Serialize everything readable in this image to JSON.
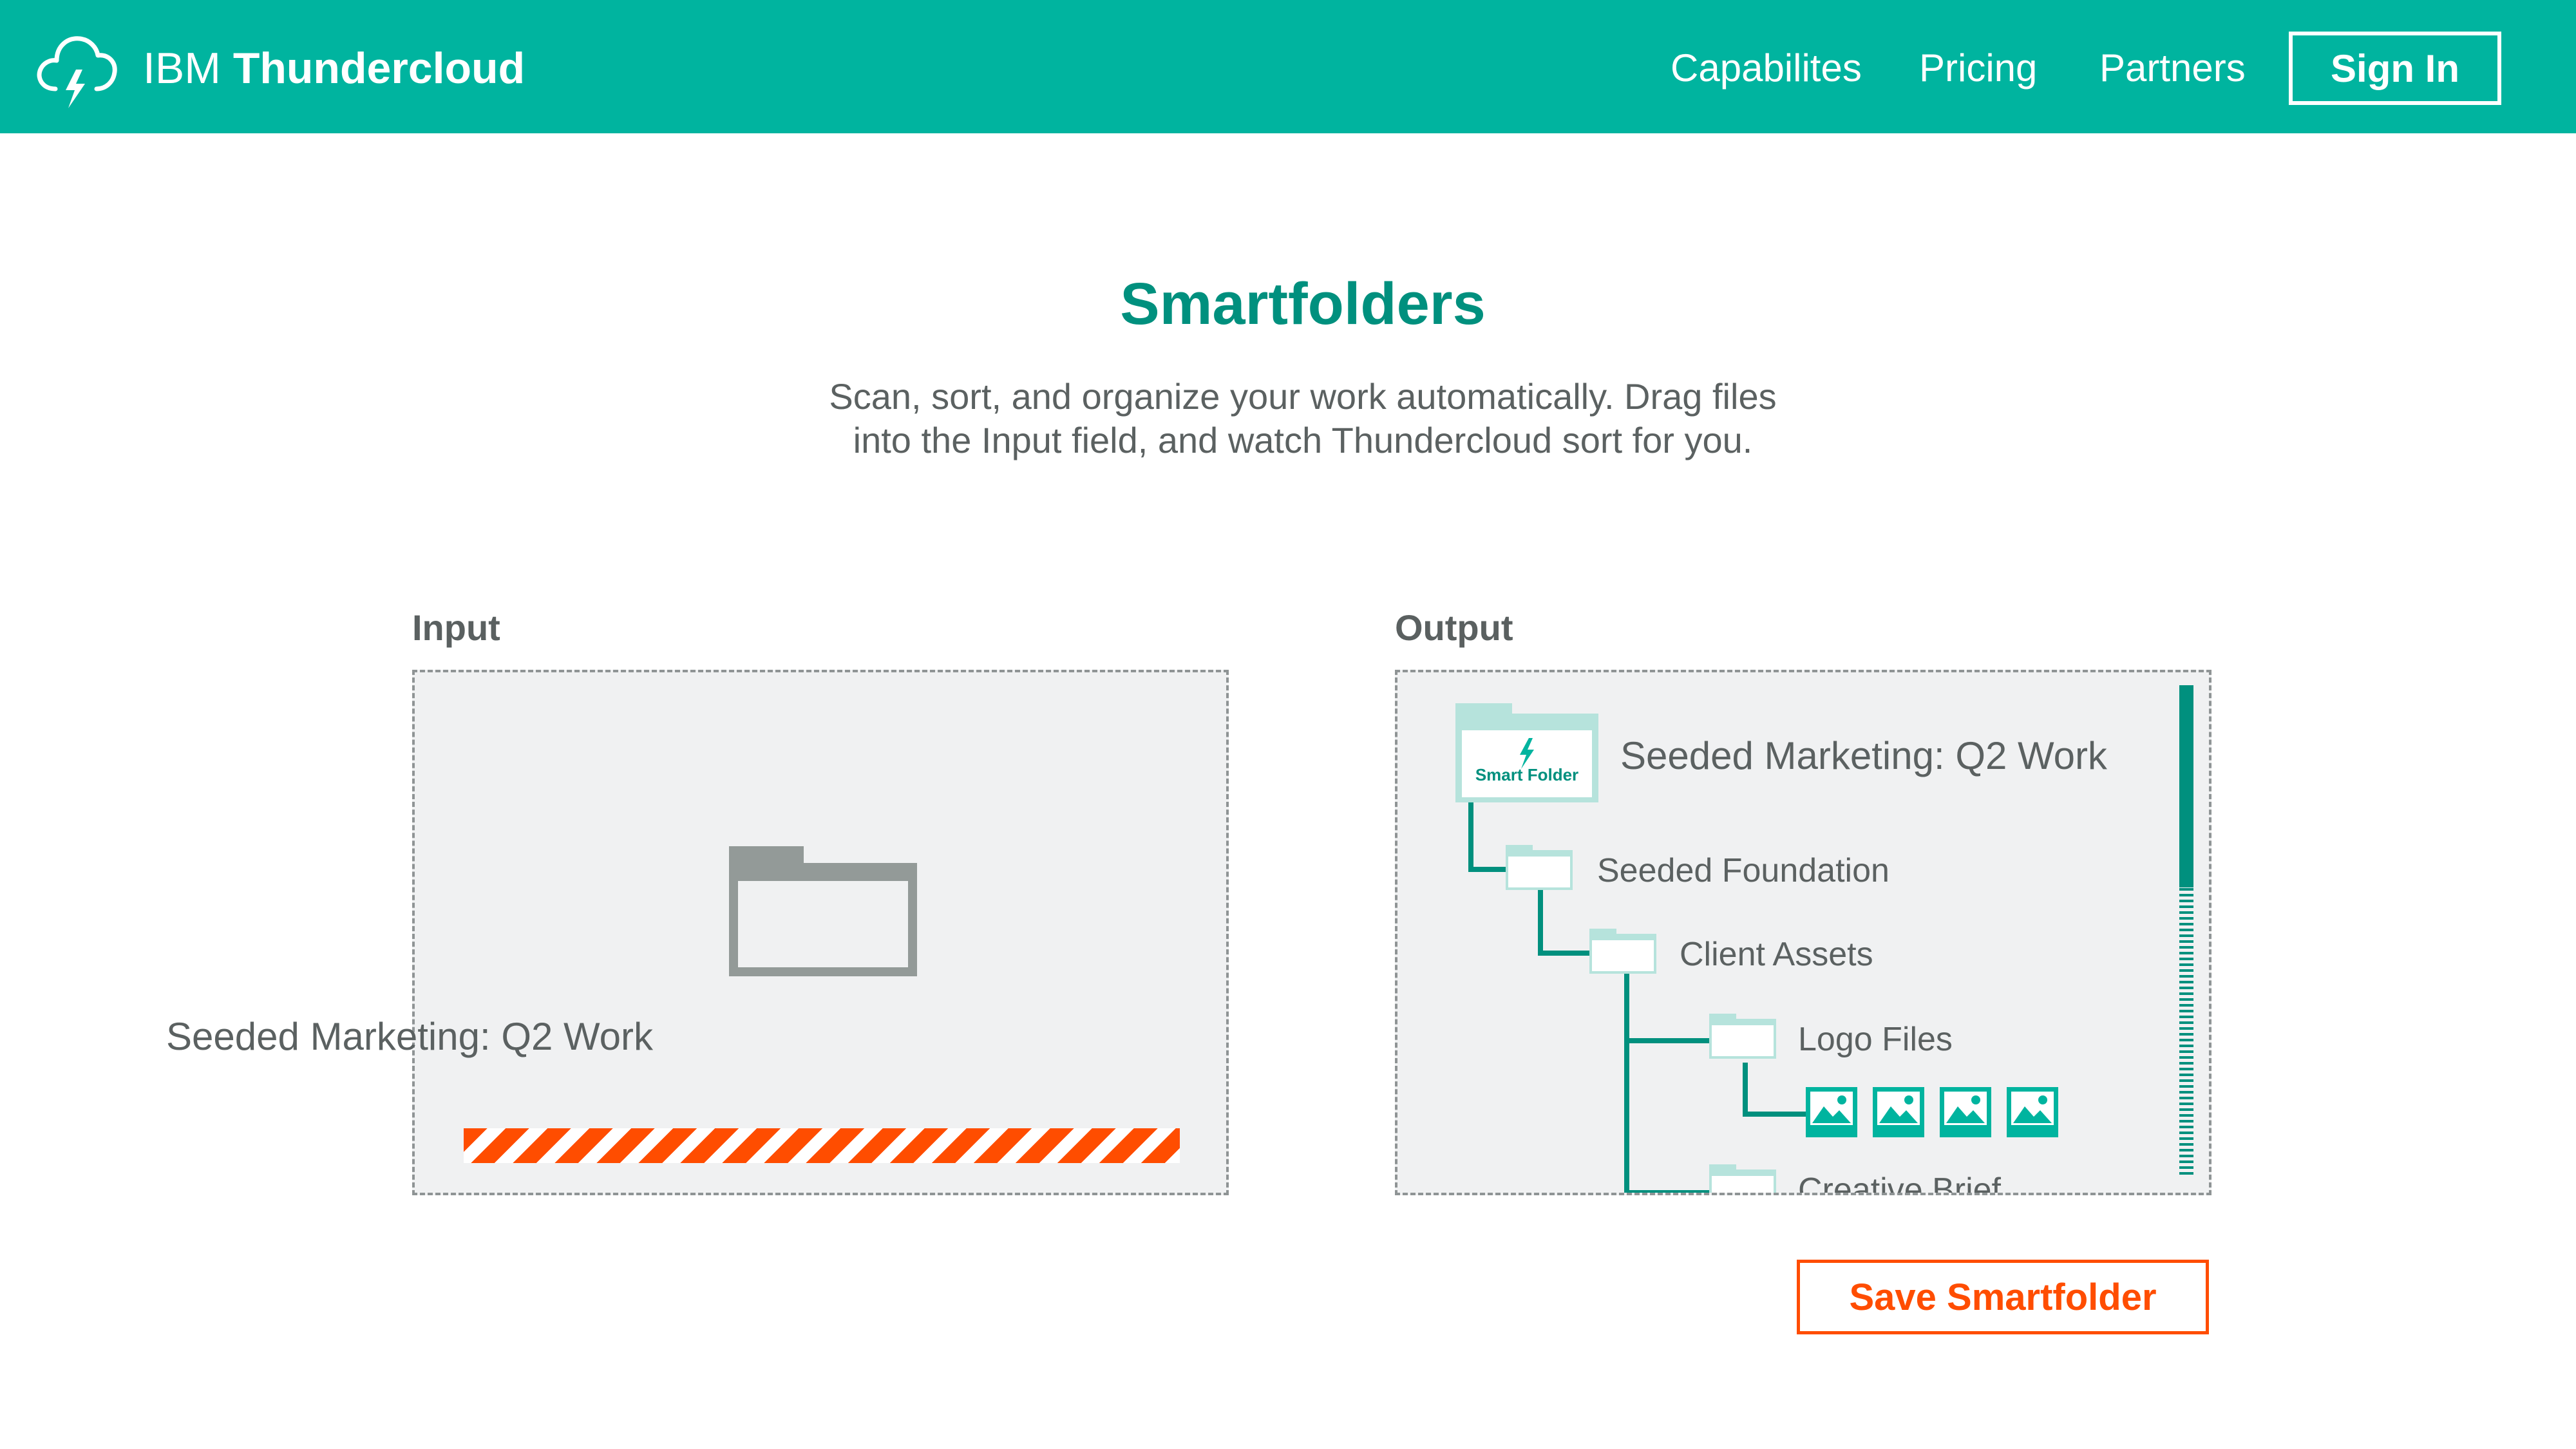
{
  "header": {
    "brand_prefix": "IBM",
    "brand_name": "Thundercloud",
    "brand_icon": "cloud-lightning-icon",
    "nav": [
      "Capabilites",
      "Pricing",
      "Partners"
    ],
    "sign_in_label": "Sign In"
  },
  "hero": {
    "title": "Smartfolders",
    "subtitle_line1": "Scan, sort, and organize your work automatically. Drag files",
    "subtitle_line2": "into the Input field, and watch Thundercloud sort for you."
  },
  "input_panel": {
    "label": "Input",
    "folder_icon": "folder-icon",
    "folder_name": "Seeded Marketing: Q2 Work",
    "progress_style": "striped-indeterminate"
  },
  "output_panel": {
    "label": "Output",
    "smart_folder_badge": "Smart Folder",
    "root_name": "Seeded Marketing: Q2 Work",
    "children": [
      "Seeded Foundation",
      "Client Assets",
      "Logo Files",
      "Creative Brief"
    ],
    "image_file_icon": "image-file-icon",
    "image_file_count": 4
  },
  "save_button_label": "Save Smartfolder",
  "colors": {
    "brand_teal": "#00b49f",
    "dark_teal": "#00907e",
    "accent_orange": "#ff4d00",
    "text_gray": "#5b6161",
    "panel_bg": "#f0f1f2"
  }
}
